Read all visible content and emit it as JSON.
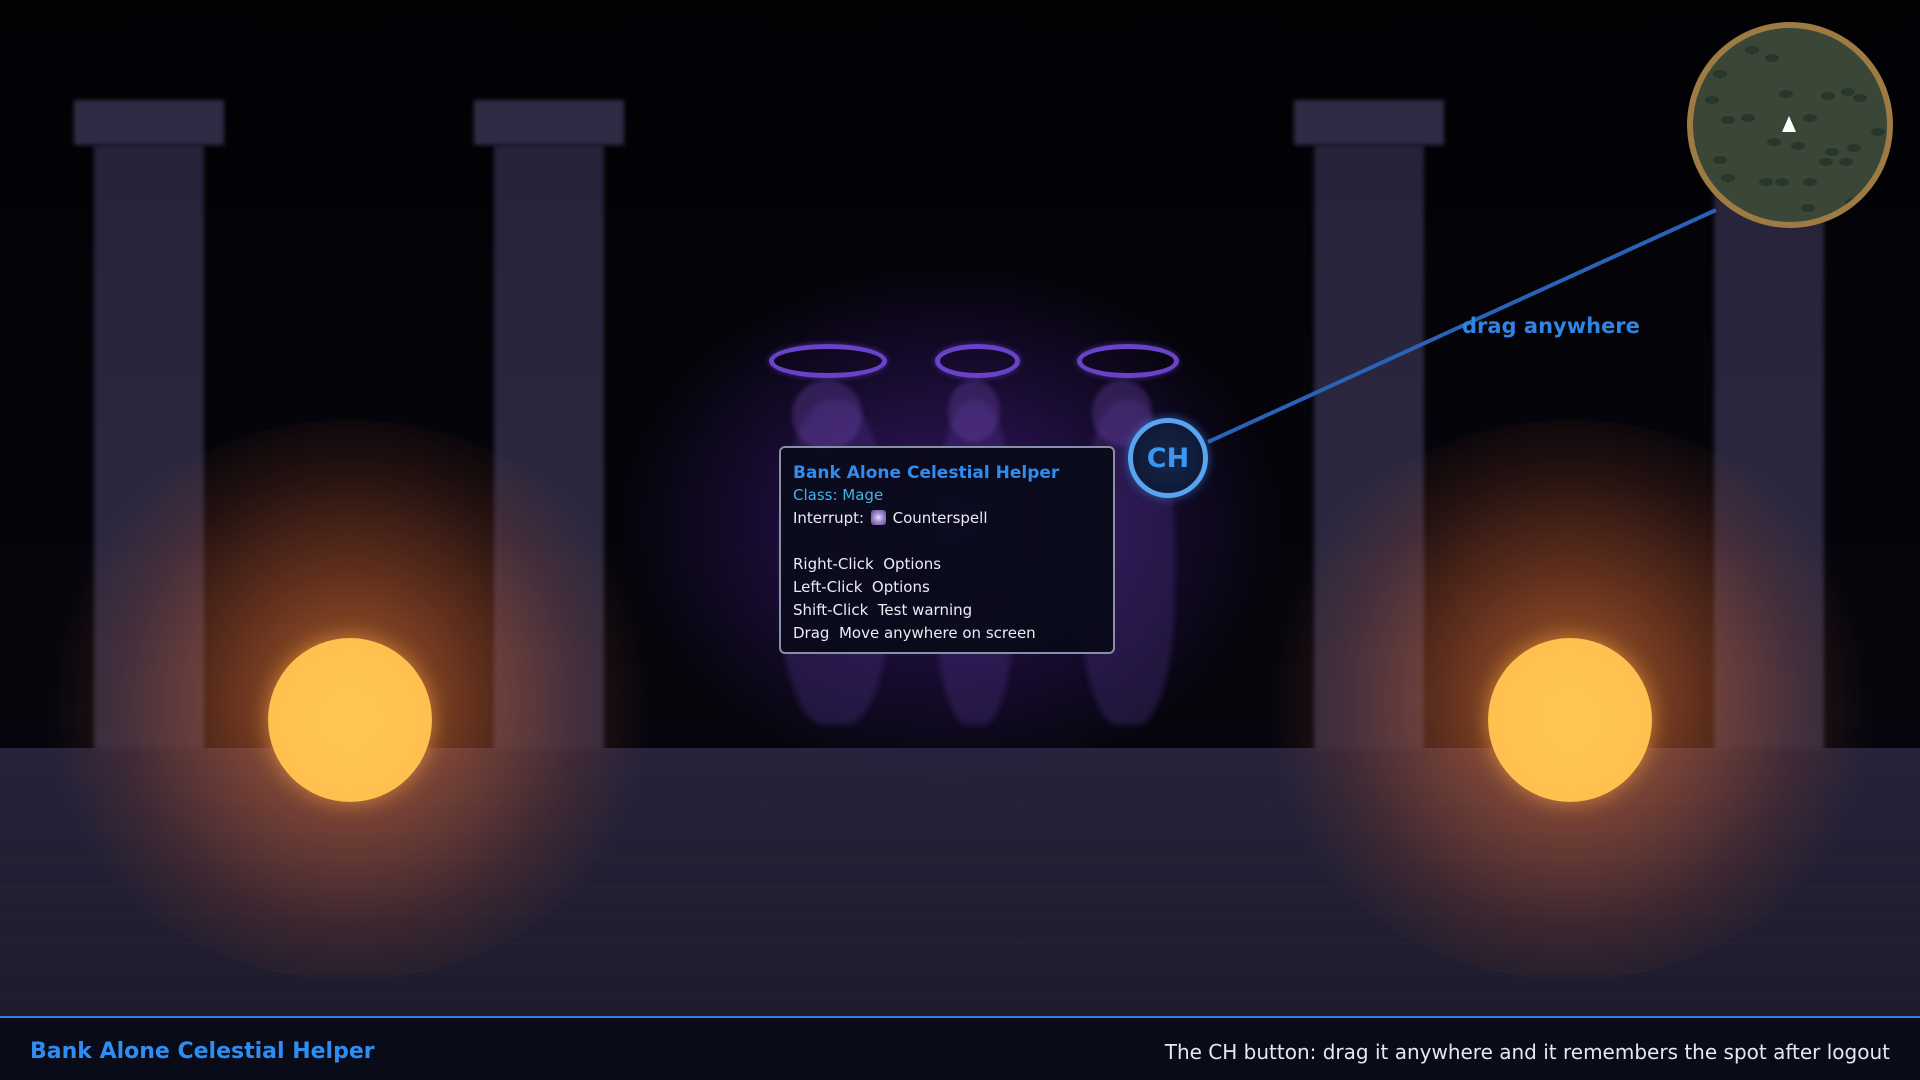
{
  "tooltip": {
    "title": "Bank Alone Celestial Helper",
    "class_line": "Class: Mage",
    "interrupt_prefix": "Interrupt:",
    "interrupt_spell": "Counterspell",
    "interrupt_icon": "counterspell-icon",
    "lines": [
      "Right-Click  Options",
      "Left-Click  Options",
      "Shift-Click  Test warning",
      "Drag  Move anywhere on screen"
    ]
  },
  "button": {
    "label": "CH"
  },
  "callout": {
    "text": "drag anywhere"
  },
  "bottom_bar": {
    "title": "Bank Alone Celestial Helper",
    "info": "The CH button: drag it anywhere and it remembers the spot after logout"
  },
  "colors": {
    "accent": "#2f8cf0",
    "class_color": "#3fb3e8",
    "minimap_border": "#9d7b43",
    "sun": "#ffc653",
    "halo": "#6a42c8"
  }
}
